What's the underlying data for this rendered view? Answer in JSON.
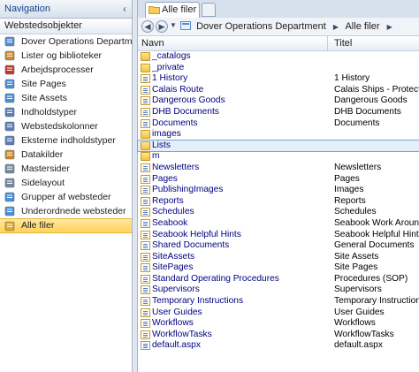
{
  "navigation": {
    "header": "Navigation",
    "group_label": "Webstedsobjekter",
    "items": [
      {
        "label": "Dover Operations Department",
        "icon": "site-icon",
        "color": "#5b8bd0"
      },
      {
        "label": "Lister og biblioteker",
        "icon": "lists-icon",
        "color": "#d08a2e"
      },
      {
        "label": "Arbejdsprocesser",
        "icon": "workflow-icon",
        "color": "#c0392b"
      },
      {
        "label": "Site Pages",
        "icon": "pages-icon",
        "color": "#4a90d9"
      },
      {
        "label": "Site Assets",
        "icon": "assets-icon",
        "color": "#4a90d9"
      },
      {
        "label": "Indholdstyper",
        "icon": "content-types-icon",
        "color": "#5b7fb5"
      },
      {
        "label": "Webstedskolonner",
        "icon": "columns-icon",
        "color": "#5b7fb5"
      },
      {
        "label": "Eksterne indholdstyper",
        "icon": "external-types-icon",
        "color": "#5b7fb5"
      },
      {
        "label": "Datakilder",
        "icon": "data-sources-icon",
        "color": "#d08a2e"
      },
      {
        "label": "Mastersider",
        "icon": "master-pages-icon",
        "color": "#7a8a9e"
      },
      {
        "label": "Sidelayout",
        "icon": "page-layout-icon",
        "color": "#7a8a9e"
      },
      {
        "label": "Grupper af websteder",
        "icon": "groups-icon",
        "color": "#4a90d9"
      },
      {
        "label": "Underordnede websteder",
        "icon": "subsites-icon",
        "color": "#4a90d9"
      },
      {
        "label": "Alle filer",
        "icon": "all-files-icon",
        "color": "#e6a81e",
        "selected": true
      }
    ]
  },
  "tab": {
    "label": "Alle filer"
  },
  "breadcrumb": {
    "items": [
      "Dover Operations Department",
      "Alle filer"
    ]
  },
  "grid": {
    "columns": [
      "Navn",
      "Titel"
    ],
    "rows": [
      {
        "name": "_catalogs",
        "title": "",
        "icon": "folder"
      },
      {
        "name": "_private",
        "title": "",
        "icon": "folder"
      },
      {
        "name": "1 History",
        "title": "1 History",
        "icon": "list"
      },
      {
        "name": "Calais Route",
        "title": "Calais Ships - Protected",
        "icon": "list"
      },
      {
        "name": "Dangerous Goods",
        "title": "Dangerous Goods",
        "icon": "list"
      },
      {
        "name": "DHB Documents",
        "title": "DHB Documents",
        "icon": "list"
      },
      {
        "name": "Documents",
        "title": "Documents",
        "icon": "list"
      },
      {
        "name": "images",
        "title": "",
        "icon": "folder"
      },
      {
        "name": "Lists",
        "title": "",
        "icon": "folder",
        "selected": true
      },
      {
        "name": "m",
        "title": "",
        "icon": "folder"
      },
      {
        "name": "Newsletters",
        "title": "Newsletters",
        "icon": "list"
      },
      {
        "name": "Pages",
        "title": "Pages",
        "icon": "list"
      },
      {
        "name": "PublishingImages",
        "title": "Images",
        "icon": "list"
      },
      {
        "name": "Reports",
        "title": "Reports",
        "icon": "list"
      },
      {
        "name": "Schedules",
        "title": "Schedules",
        "icon": "list"
      },
      {
        "name": "Seabook",
        "title": "Seabook Work Arounds",
        "icon": "list"
      },
      {
        "name": "Seabook Helpful Hints",
        "title": "Seabook Helpful Hints",
        "icon": "list"
      },
      {
        "name": "Shared Documents",
        "title": "General Documents",
        "icon": "list"
      },
      {
        "name": "SiteAssets",
        "title": "Site Assets",
        "icon": "list"
      },
      {
        "name": "SitePages",
        "title": "Site Pages",
        "icon": "list"
      },
      {
        "name": "Standard Operating Procedures",
        "title": "Procedures (SOP)",
        "icon": "list"
      },
      {
        "name": "Supervisors",
        "title": "Supervisors",
        "icon": "list"
      },
      {
        "name": "Temporary Instructions",
        "title": "Temporary Instructions",
        "icon": "list"
      },
      {
        "name": "User Guides",
        "title": "User Guides",
        "icon": "list"
      },
      {
        "name": "Workflows",
        "title": "Workflows",
        "icon": "list"
      },
      {
        "name": "WorkflowTasks",
        "title": "WorkflowTasks",
        "icon": "list"
      },
      {
        "name": "default.aspx",
        "title": "default.aspx",
        "icon": "file"
      }
    ]
  }
}
